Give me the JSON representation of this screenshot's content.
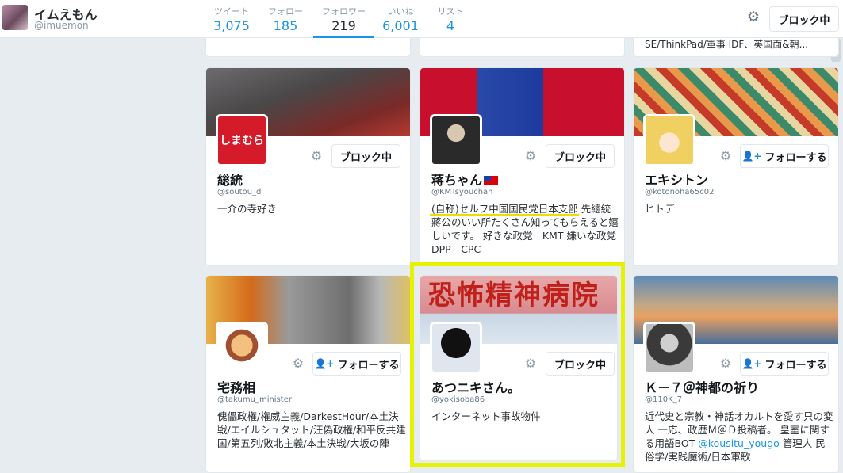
{
  "profile": {
    "name": "イムえもん",
    "handle": "@imuemon"
  },
  "nav": [
    {
      "label": "ツイート",
      "value": "3,075"
    },
    {
      "label": "フォロー",
      "value": "185"
    },
    {
      "label": "フォロワー",
      "value": "219"
    },
    {
      "label": "いいね",
      "value": "6,001"
    },
    {
      "label": "リスト",
      "value": "4"
    }
  ],
  "header": {
    "block_label": "ブロック中"
  },
  "stub_text": "SE/ThinkPad/軍事 IDF、英国面&朝...",
  "cards": [
    {
      "name": "総統",
      "handle": "@soutou_d",
      "bio": "一介の寺好き",
      "button": "ブロック中",
      "avatar_text": "しまむら"
    },
    {
      "name": "蒋ちゃん",
      "handle": "@KMTsyouchan",
      "bio": "(自称)セルフ中国国民党日本支部 先總統蔣公のいい所たくさん知ってもらえると嬉しいです。 好きな政党　KMT 嫌いな政党　DPP　CPC",
      "button": "ブロック中"
    },
    {
      "name": "エキシトン",
      "handle": "@kotonoha65c02",
      "bio": "ヒトデ",
      "button": "フォローする"
    },
    {
      "name": "宅務相",
      "handle": "@takumu_minister",
      "bio": "傀儡政権/権威主義/DarkestHour/本土決戦/エイルシュタット/汪偽政権/和平反共建国/第五列/敗北主義/本土決戦/大坂の陣",
      "button": "フォローする"
    },
    {
      "name": "あつニキさん。",
      "handle": "@yokisoba86",
      "bio": "インターネット事故物件",
      "button": "ブロック中",
      "banner_text": "恐怖精神病院"
    },
    {
      "name": "Ｋ－７＠神都の祈り",
      "handle": "@110K_7",
      "bio_pre": "近代史と宗教・神話オカルトを愛す只の変人 一応、政歴Ｍ＠Ｄ投稿者。 皇室に関する用語BOT ",
      "bio_link": "@kousitu_yougo",
      "bio_post": " 管理人 民俗学/実践魔術/日本軍歌",
      "button": "フォローする"
    }
  ],
  "icons": {
    "gear": "gear-icon",
    "follow": "person-plus-icon"
  },
  "colors": {
    "accent": "#1b95e0",
    "highlight": "#e6f200"
  }
}
